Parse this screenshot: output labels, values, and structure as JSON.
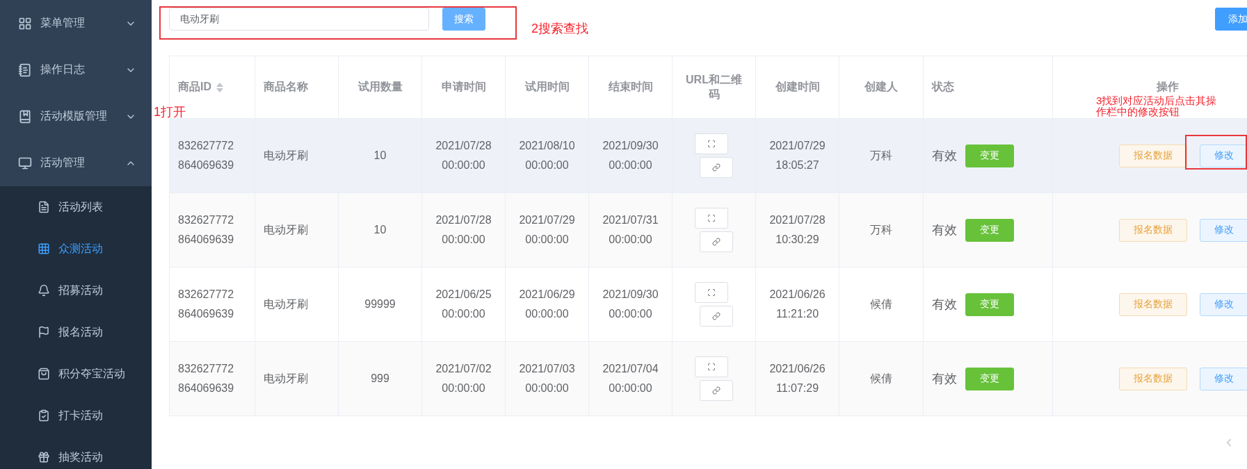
{
  "sidebar": {
    "menus": [
      {
        "label": "菜单管理",
        "expanded": false
      },
      {
        "label": "操作日志",
        "expanded": false
      },
      {
        "label": "活动模版管理",
        "expanded": false
      },
      {
        "label": "活动管理",
        "expanded": true,
        "children": [
          {
            "label": "活动列表",
            "selected": false
          },
          {
            "label": "众测活动",
            "selected": true
          },
          {
            "label": "招募活动",
            "selected": false
          },
          {
            "label": "报名活动",
            "selected": false
          },
          {
            "label": "积分夺宝活动",
            "selected": false
          },
          {
            "label": "打卡活动",
            "selected": false
          },
          {
            "label": "抽奖活动",
            "selected": false
          }
        ]
      }
    ]
  },
  "search": {
    "value": "电动牙刷",
    "button": "搜索"
  },
  "add_button": "添加",
  "table": {
    "columns": [
      {
        "label": "商品ID",
        "sortable": true
      },
      {
        "label": "商品名称"
      },
      {
        "label": "试用数量"
      },
      {
        "label": "申请时间"
      },
      {
        "label": "试用时间"
      },
      {
        "label": "结束时间"
      },
      {
        "label": "URL和二维码"
      },
      {
        "label": "创建时间"
      },
      {
        "label": "创建人"
      },
      {
        "label": "状态"
      },
      {
        "label": "操作"
      }
    ],
    "rows": [
      {
        "highlighted": true,
        "id": "832627772864069639",
        "name": "电动牙刷",
        "quantity": "10",
        "apply_time": "2021/07/28 00:00:00",
        "trial_time": "2021/08/10 00:00:00",
        "end_time": "2021/09/30 00:00:00",
        "created_time": "2021/07/29 18:05:27",
        "creator": "万科",
        "status": "有效",
        "status_button": "变更",
        "actions": [
          "报名数据",
          "修改"
        ]
      },
      {
        "highlighted": false,
        "id": "832627772864069639",
        "name": "电动牙刷",
        "quantity": "10",
        "apply_time": "2021/07/28 00:00:00",
        "trial_time": "2021/07/29 00:00:00",
        "end_time": "2021/07/31 00:00:00",
        "created_time": "2021/07/28 10:30:29",
        "creator": "万科",
        "status": "有效",
        "status_button": "变更",
        "actions": [
          "报名数据",
          "修改"
        ]
      },
      {
        "highlighted": false,
        "id": "832627772864069639",
        "name": "电动牙刷",
        "quantity": "99999",
        "apply_time": "2021/06/25 00:00:00",
        "trial_time": "2021/06/29 00:00:00",
        "end_time": "2021/09/30 00:00:00",
        "created_time": "2021/06/26 11:21:20",
        "creator": "候倩",
        "status": "有效",
        "status_button": "变更",
        "actions": [
          "报名数据",
          "修改"
        ]
      },
      {
        "highlighted": false,
        "id": "832627772864069639",
        "name": "电动牙刷",
        "quantity": "999",
        "apply_time": "2021/07/02 00:00:00",
        "trial_time": "2021/07/03 00:00:00",
        "end_time": "2021/07/04 00:00:00",
        "created_time": "2021/06/26 11:07:29",
        "creator": "候倩",
        "status": "有效",
        "status_button": "变更",
        "actions": [
          "报名数据",
          "修改"
        ]
      }
    ]
  },
  "annotations": [
    {
      "text": "1打开"
    },
    {
      "text": "2搜索查找"
    },
    {
      "text": "3找到对应活动后点击其操作栏中的修改按钮"
    }
  ]
}
